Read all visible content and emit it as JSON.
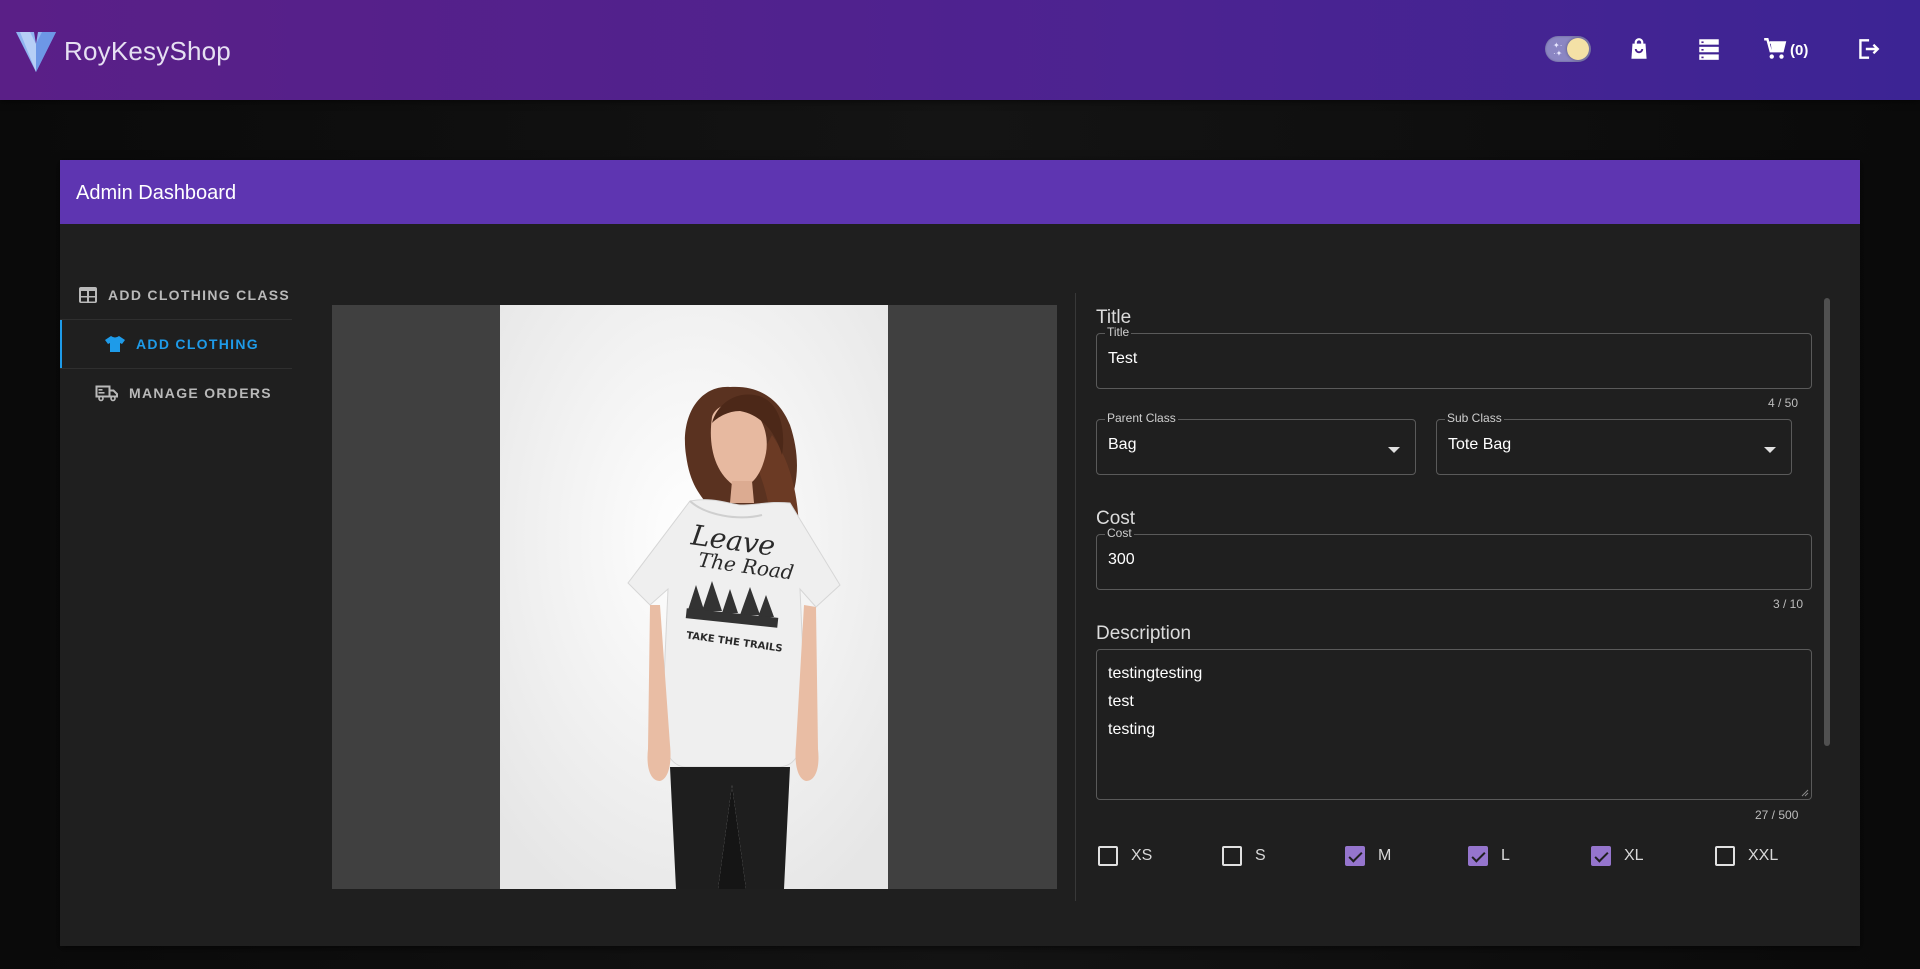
{
  "header": {
    "brand": "RoyKesyShop",
    "cart_count": "(0)",
    "icons": [
      "theme-toggle",
      "shopping-bag-icon",
      "server-icon",
      "cart-icon",
      "logout-icon"
    ],
    "gradient_start": "#5a1f87",
    "gradient_end": "#3c2494"
  },
  "dashboard": {
    "title": "Admin Dashboard",
    "header_color": "#5e35b1"
  },
  "sidebar": {
    "items": [
      {
        "label": "ADD CLOTHING CLASS",
        "icon": "table-icon",
        "active": false
      },
      {
        "label": "ADD CLOTHING",
        "icon": "tshirt-icon",
        "active": true
      },
      {
        "label": "MANAGE ORDERS",
        "icon": "truck-icon",
        "active": false
      }
    ],
    "active_color": "#1e9be9"
  },
  "form": {
    "title_section": "Title",
    "title_label": "Title",
    "title_value": "Test",
    "title_counter": "4 / 50",
    "parent_class_label": "Parent Class",
    "parent_class_value": "Bag",
    "sub_class_label": "Sub Class",
    "sub_class_value": "Tote Bag",
    "cost_section": "Cost",
    "cost_label": "Cost",
    "cost_value": "300",
    "cost_counter": "3 / 10",
    "description_section": "Description",
    "description_lines": [
      "testingtesting",
      "test",
      "testing"
    ],
    "description_counter": "27 / 500",
    "sizes": [
      {
        "label": "XS",
        "checked": false
      },
      {
        "label": "S",
        "checked": false
      },
      {
        "label": "M",
        "checked": true
      },
      {
        "label": "L",
        "checked": true
      },
      {
        "label": "XL",
        "checked": true
      },
      {
        "label": "XXL",
        "checked": false
      }
    ],
    "checkbox_color": "#9575cd"
  },
  "preview": {
    "shirt_text_1": "Leave",
    "shirt_text_2": "The Road",
    "shirt_text_3": "TAKE THE TRAILS"
  }
}
